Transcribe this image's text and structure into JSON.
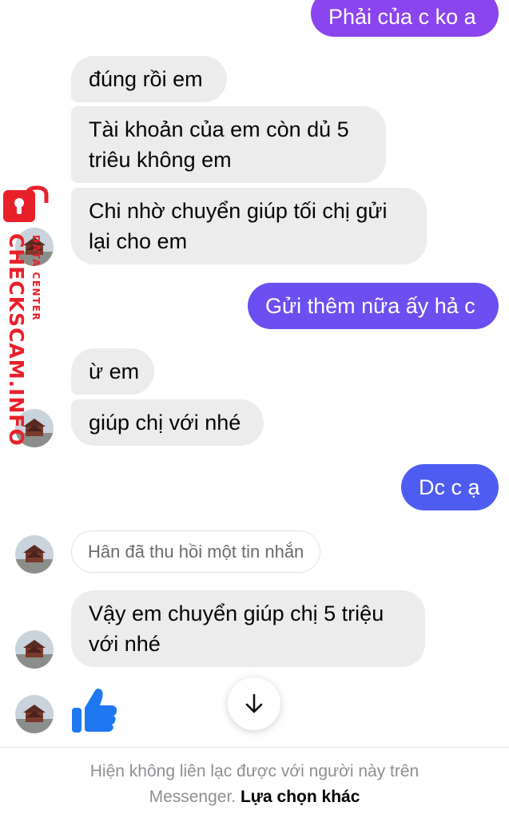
{
  "messages": {
    "m1": "Phải của c ko a",
    "m2": "đúng rồi em",
    "m3_line1": "Tài khoản của em còn dủ 5",
    "m3_line2": "triêu không em",
    "m4_line1": "Chi nhờ chuyển giúp tối chị gửi",
    "m4_line2": "lại cho em",
    "m5": "Gửi thêm nữa ấy hả c",
    "m6": "ừ em",
    "m7": "giúp chị với nhé",
    "m8": "Dc c ạ",
    "recalled": "Hân đã thu hồi một tin nhắn",
    "m9_line1": "Vậy em chuyển giúp chị 5 triệu",
    "m9_line2": "với nhé"
  },
  "footer": {
    "notice_line1": "Hiện không liên lạc được với người này trên",
    "notice_line2": "Messenger.",
    "link": "Lựa chọn khác"
  },
  "watermark": {
    "brand": "CHECKSCAM.INFO",
    "sub": "DATA CENTER"
  },
  "icons": {
    "like": "thumbs-up-icon",
    "scroll": "arrow-down-icon",
    "watermark_lock": "lock-icon"
  },
  "colors": {
    "outgoing_purple": "#8a45ee",
    "outgoing_violet": "#6c4ff0",
    "outgoing_blue": "#4e5cf2",
    "incoming": "#ececed",
    "like_blue": "#1f78f2",
    "watermark_red": "#e8202a"
  }
}
